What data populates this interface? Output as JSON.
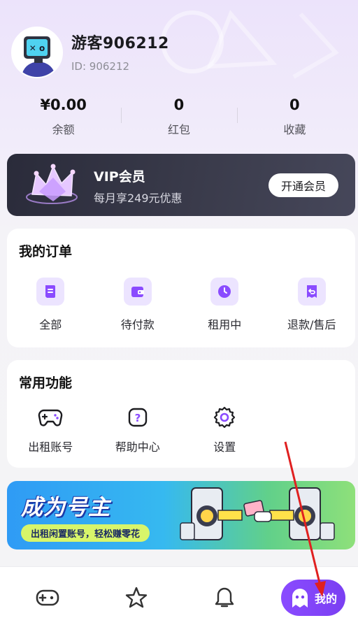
{
  "profile": {
    "username": "游客906212",
    "user_id": "ID: 906212"
  },
  "stats": [
    {
      "value": "¥0.00",
      "label": "余额"
    },
    {
      "value": "0",
      "label": "红包"
    },
    {
      "value": "0",
      "label": "收藏"
    }
  ],
  "vip": {
    "title": "VIP会员",
    "subtitle": "每月享249元优惠",
    "button": "开通会员"
  },
  "orders": {
    "title": "我的订单",
    "items": [
      {
        "label": "全部",
        "icon": "document-icon"
      },
      {
        "label": "待付款",
        "icon": "wallet-icon"
      },
      {
        "label": "租用中",
        "icon": "clock-icon"
      },
      {
        "label": "退款/售后",
        "icon": "refund-icon"
      }
    ]
  },
  "functions": {
    "title": "常用功能",
    "items": [
      {
        "label": "出租账号",
        "icon": "gamepad-icon"
      },
      {
        "label": "帮助中心",
        "icon": "help-icon"
      },
      {
        "label": "设置",
        "icon": "gear-icon"
      }
    ]
  },
  "banner": {
    "title": "成为号主",
    "tagline": "出租闲置账号，轻松赚零花"
  },
  "tabbar": {
    "items": [
      {
        "icon": "gamepad-icon"
      },
      {
        "icon": "star-icon"
      },
      {
        "icon": "bell-icon"
      },
      {
        "icon": "ghost-icon",
        "label": "我的",
        "active": true
      }
    ]
  },
  "colors": {
    "accent": "#8a4bff",
    "icon_bg": "#ece4ff",
    "vip_bg": "#2e2f3e",
    "annotation": "#e02020"
  }
}
